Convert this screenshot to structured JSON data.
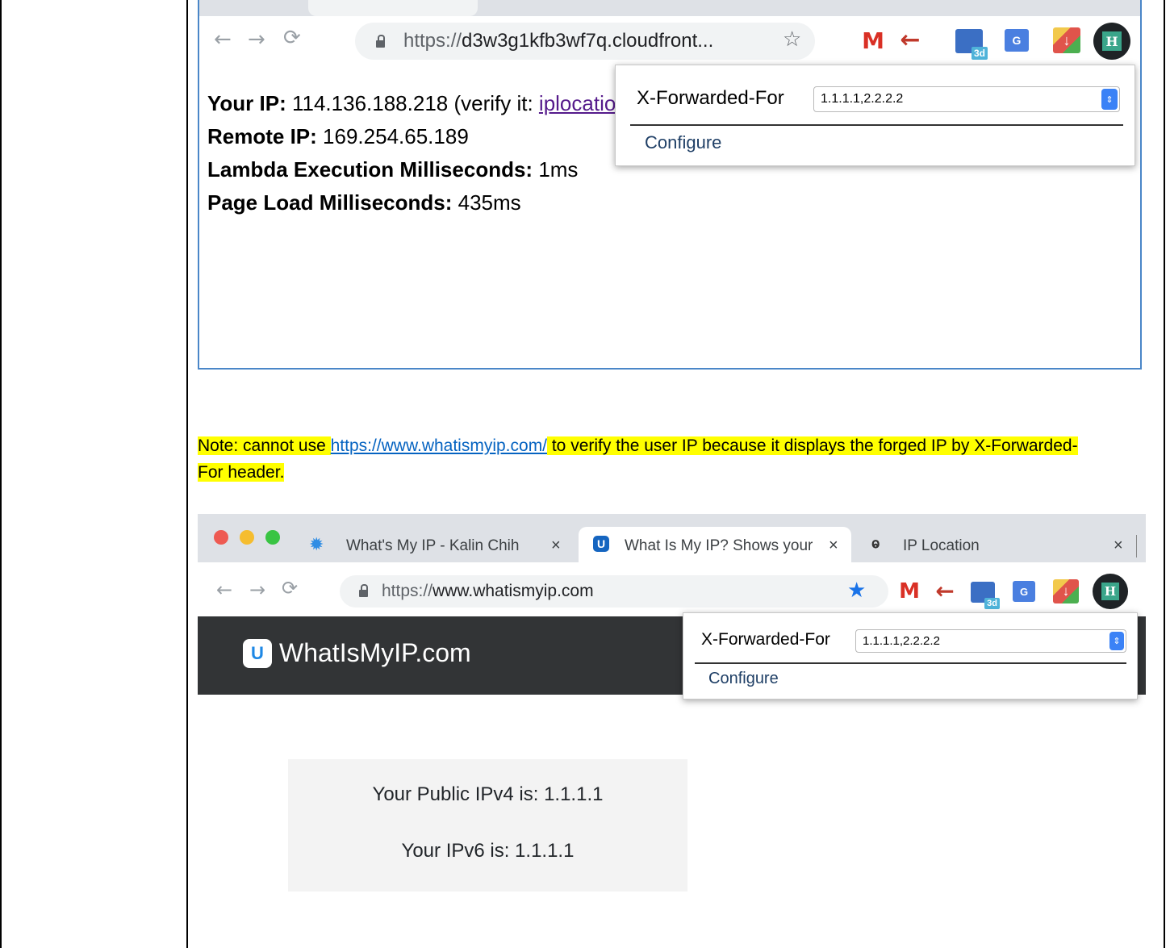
{
  "screenshot1": {
    "url_scheme": "https://",
    "url_host": "d3w3g1kfb3wf7q.cloudfront...",
    "star_icon": "☆",
    "popup": {
      "header_label": "X-Forwarded-For",
      "header_value": "1.1.1.1,2.2.2.2",
      "configure_label": "Configure"
    },
    "info": {
      "your_ip_label": "Your IP:",
      "your_ip_value": "114.136.188.218 (verify it: ",
      "verify_link": "iplocation.net",
      "remote_ip_label": "Remote IP:",
      "remote_ip_value": "169.254.65.189",
      "lambda_label": "Lambda Execution Milliseconds:",
      "lambda_value": "1ms",
      "page_load_label": "Page Load Milliseconds:",
      "page_load_value": "435ms"
    }
  },
  "note": {
    "prefix": "Note: cannot use ",
    "link": "https://www.whatismyip.com/",
    "suffix": " to verify the user IP because it displays the forged IP by X-Forwarded-For header."
  },
  "screenshot2": {
    "tabs": [
      {
        "title": "What's My IP - Kalin Chih",
        "close": "×"
      },
      {
        "title": "What Is My IP? Shows your",
        "close": "×"
      },
      {
        "title": "IP Location",
        "close": "×"
      }
    ],
    "url_scheme": "https://",
    "url_host": "www.whatismyip.com",
    "site_title": "WhatIsMyIP.com",
    "popup": {
      "header_label": "X-Forwarded-For",
      "header_value": "1.1.1.1,2.2.2.2",
      "configure_label": "Configure"
    },
    "ipv4_text": "Your Public IPv4 is: 1.1.1.1",
    "ipv6_text": "Your IPv6 is: 1.1.1.1"
  },
  "extensions": {
    "gmail_letter": "M",
    "calendar_badge": "3d",
    "translate_letter": "G",
    "hackers_letter": "H"
  }
}
